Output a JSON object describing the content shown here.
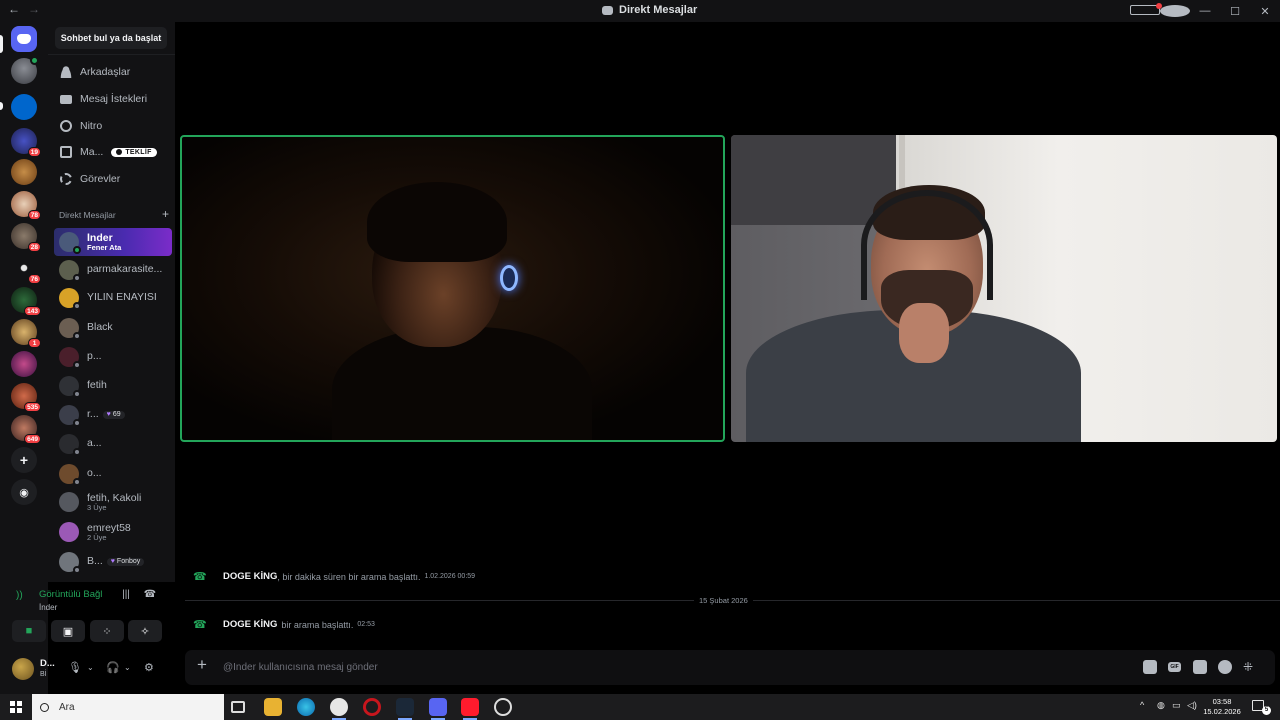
{
  "window": {
    "title": "Direkt Mesajlar"
  },
  "sidebar": {
    "search_label": "Sohbet bul ya da başlat",
    "nav": [
      {
        "label": "Arkadaşlar",
        "icon": "friends-icon"
      },
      {
        "label": "Mesaj İstekleri",
        "icon": "mail-icon"
      },
      {
        "label": "Nitro",
        "icon": "nitro-icon"
      },
      {
        "label": "Ma...",
        "icon": "shop-icon",
        "tag": "TEKLİF"
      },
      {
        "label": "Görevler",
        "icon": "quests-icon"
      }
    ],
    "dm_header": "Direkt Mesajlar",
    "dms": [
      {
        "name": "İnder",
        "sub": "Fener Ata",
        "status": "online",
        "active": true,
        "avatar": "#4a5a7a"
      },
      {
        "name": "parmakarasite...",
        "sub": "",
        "status": "offline",
        "avatar": "#5c5f4e"
      },
      {
        "name": "YILIN ENAYİSİ",
        "sub": "",
        "status": "offline",
        "avatar": "#d8a227"
      },
      {
        "name": "Black",
        "sub": "",
        "status": "offline",
        "avatar": "#6b5e52"
      },
      {
        "name": "p...",
        "sub": "",
        "status": "offline",
        "avatar": "#4a1f2b"
      },
      {
        "name": "fetih",
        "sub": "",
        "status": "offline",
        "avatar": "#2f3136"
      },
      {
        "name": "r...",
        "sub": "",
        "status": "offline",
        "avatar": "#3b3e4a",
        "tag": "69"
      },
      {
        "name": "a...",
        "sub": "",
        "status": "offline",
        "avatar": "#2a2b2f"
      },
      {
        "name": "o...",
        "sub": "",
        "status": "offline",
        "avatar": "#6e4b2d"
      },
      {
        "name": "fetih, Kakoli",
        "sub": "3 Üye",
        "status": "group",
        "avatar": "#55585f"
      },
      {
        "name": "emreyt58",
        "sub": "2 Üye",
        "status": "group",
        "avatar": "#9b59b6"
      },
      {
        "name": "B...",
        "sub": "",
        "status": "offline",
        "avatar": "#70757c",
        "tag": "Fonboy"
      }
    ]
  },
  "servers": {
    "badges": [
      "19",
      "78",
      "28",
      "76",
      "143",
      "1",
      "535",
      "649"
    ]
  },
  "voice": {
    "title": "Görüntülü Bağl",
    "who": "İnder"
  },
  "user": {
    "name": "D...",
    "status": "Bİ"
  },
  "chat": {
    "messages": [
      {
        "author": "DOGE KİNG",
        "text": ", bir dakika süren bir arama başlattı.",
        "time": "1.02.2026 00:59"
      },
      {
        "author": "DOGE KİNG",
        "text": "bir arama başlattı.",
        "time": "02:53"
      }
    ],
    "date_divider": "15 Şubat 2026",
    "composer_placeholder": "@İnder kullanıcısına mesaj gönder"
  },
  "taskbar": {
    "search_placeholder": "Ara",
    "time": "03:58",
    "date": "15.02.2026",
    "notifications": "5"
  },
  "colors": {
    "accent": "#5865f2",
    "online": "#23a55a",
    "danger": "#f23f43"
  }
}
